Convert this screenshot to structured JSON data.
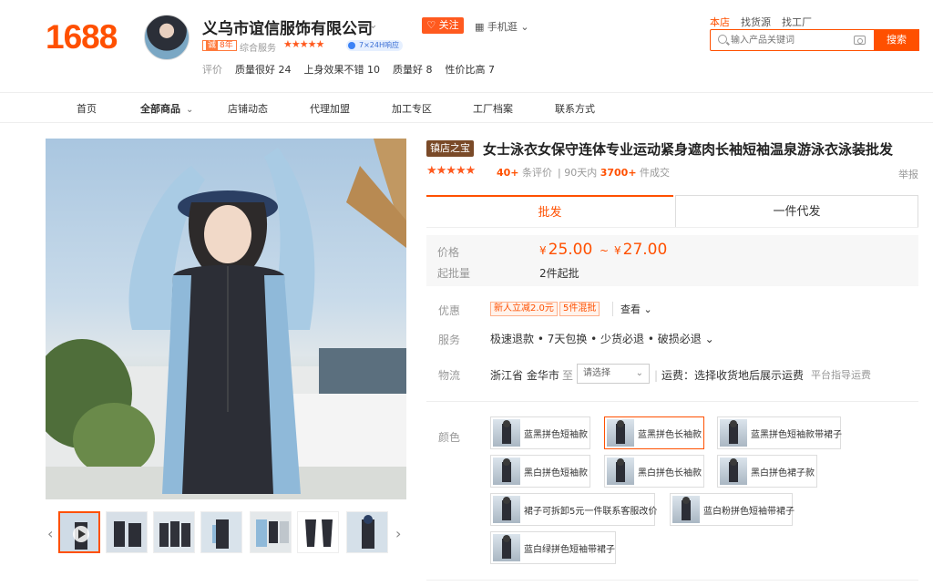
{
  "logo": "1688",
  "shop": {
    "name": "义乌市谊信服饰有限公司",
    "follow": "关注",
    "mobile": "手机逛",
    "year_badge_num": "8年",
    "service_label": "综合服务",
    "stars": "★★★★★",
    "service_badge": "7×24H响应",
    "eval_label": "评价",
    "eval_tags": [
      "质量很好 24",
      "上身效果不错 10",
      "质量好 8",
      "性价比高 7"
    ]
  },
  "top_links": [
    "本店",
    "找货源",
    "找工厂"
  ],
  "search": {
    "placeholder": "输入产品关键词",
    "button": "搜索"
  },
  "nav": [
    "首页",
    "全部商品",
    "店铺动态",
    "代理加盟",
    "加工专区",
    "工厂档案",
    "联系方式"
  ],
  "product": {
    "tag": "镇店之宝",
    "title": "女士泳衣女保守连体专业运动紧身遮肉长袖短袖温泉游泳衣泳装批发",
    "stars": "★★★★★",
    "review_num": "40+",
    "review_suffix": "条评价",
    "sold_prefix": "90天内",
    "sold_num": "3700+",
    "sold_suffix": "件成交",
    "report": "举报"
  },
  "tabs": [
    "批发",
    "一件代发"
  ],
  "price": {
    "label": "价格",
    "currency": "¥",
    "low": "25.00",
    "sep": "~",
    "high": "27.00",
    "moq_label": "起批量",
    "moq_value": "2件起批"
  },
  "promo": {
    "label": "优惠",
    "tags": [
      "新人立减2.0元",
      "5件混批"
    ],
    "view": "查看 ⌄"
  },
  "service": {
    "label": "服务",
    "text": "极速退款 • 7天包换 • 少货必退 • 破损必退 ⌄"
  },
  "logistics": {
    "label": "物流",
    "from": "浙江省 金华市",
    "to": "至",
    "select": "请选择",
    "freight_divider": "|",
    "freight": "运费：选择收货地后展示运费",
    "platform": "平台指导运费"
  },
  "colors": {
    "label": "颜色",
    "options": [
      "蓝黑拼色短袖款",
      "蓝黑拼色长袖款",
      "蓝黑拼色短袖款带裙子",
      "黑白拼色短袖款",
      "黑白拼色长袖款",
      "黑白拼色裙子款",
      "裙子可拆卸5元一件联系客服改价",
      "蓝白粉拼色短袖带裙子",
      "蓝白绿拼色短袖带裙子"
    ],
    "selected_index": 1
  },
  "accent_color": "#ff5000"
}
